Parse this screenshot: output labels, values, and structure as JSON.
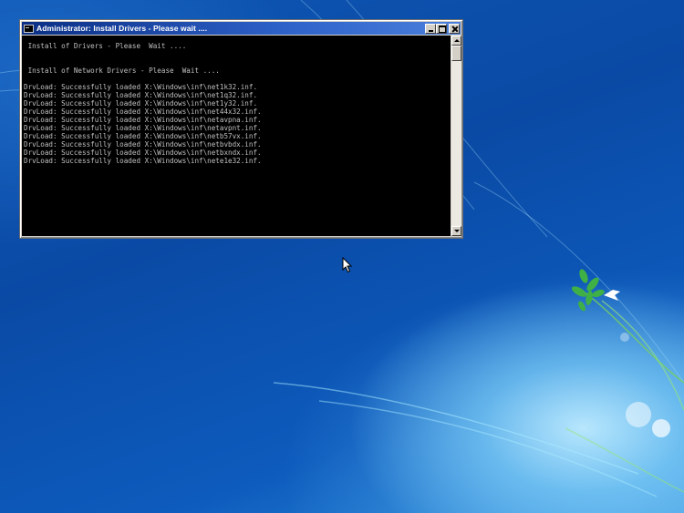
{
  "desktop": {
    "wallpaper_colors": {
      "base": "#0a4aa5",
      "glow": "#bfeaff",
      "leaf": "#3aa63a",
      "bird": "#ffffff"
    },
    "cursor_icon": "arrow-cursor-icon"
  },
  "window": {
    "title": "Administrator: Install Drivers - Please wait ....",
    "icon": "console-icon",
    "buttons": {
      "minimize": "minimize-icon",
      "maximize": "maximize-icon",
      "close": "close-icon"
    },
    "console": {
      "foreground": "#c0c0c0",
      "background": "#000000",
      "lines": [
        " Install of Drivers - Please  Wait ....",
        "",
        "",
        " Install of Network Drivers - Please  Wait ....",
        "",
        "DrvLoad: Successfully loaded X:\\Windows\\inf\\net1k32.inf.",
        "DrvLoad: Successfully loaded X:\\Windows\\inf\\net1q32.inf.",
        "DrvLoad: Successfully loaded X:\\Windows\\inf\\net1y32.inf.",
        "DrvLoad: Successfully loaded X:\\Windows\\inf\\net44x32.inf.",
        "DrvLoad: Successfully loaded X:\\Windows\\inf\\netavpna.inf.",
        "DrvLoad: Successfully loaded X:\\Windows\\inf\\netavpnt.inf.",
        "DrvLoad: Successfully loaded X:\\Windows\\inf\\netb57vx.inf.",
        "DrvLoad: Successfully loaded X:\\Windows\\inf\\netbvbdx.inf.",
        "DrvLoad: Successfully loaded X:\\Windows\\inf\\netbxndx.inf.",
        "DrvLoad: Successfully loaded X:\\Windows\\inf\\nete1e32.inf."
      ]
    }
  }
}
